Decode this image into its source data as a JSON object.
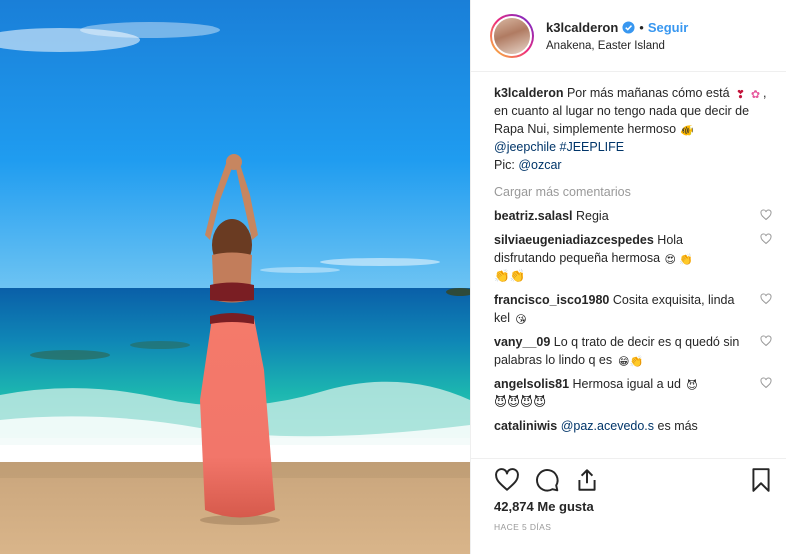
{
  "post": {
    "username": "k3lcalderon",
    "follow_label": "Seguir",
    "separator": "•",
    "location": "Anakena, Easter Island"
  },
  "caption": {
    "username": "k3lcalderon",
    "text_1": "Por más mañanas cómo está",
    "emoji_1": "❣",
    "emoji_2": "✿",
    "text_2": ", en cuanto al lugar no tengo nada que decir de Rapa Nui, simplemente hermoso",
    "emoji_3": "🐠",
    "mention_1": "@jeepchile",
    "hashtag_1": "#JEEPLIFE",
    "pic_label": "Pic:",
    "mention_2": "@ozcar"
  },
  "load_more_label": "Cargar más comentarios",
  "comments": [
    {
      "user": "beatriz.salasl",
      "text": "Regia"
    },
    {
      "user": "silviaeugeniadiazcespedes",
      "text": "Hola disfrutando pequeña hermosa",
      "emojis": "😍 👏",
      "emojis_2": "👏👏"
    },
    {
      "user": "francisco_isco1980",
      "text": "Cosita exquisita, linda kel",
      "emojis": "😘"
    },
    {
      "user": "vany__09",
      "text": "Lo q trato de decir es q quedó sin palabras lo lindo q es",
      "emojis": "😁👏"
    },
    {
      "user": "angelsolis81",
      "text": "Hermosa igual a ud",
      "emojis": "😈",
      "emojis_2": "😈😈😈😈"
    },
    {
      "user": "cataliniwis",
      "mention": "@paz.acevedo.s",
      "text": "es más"
    }
  ],
  "likes": "42,874 Me gusta",
  "timestamp": "HACE 5 DÍAS",
  "colors": {
    "accent": "#3897f0",
    "link": "#003569",
    "muted": "#999999",
    "text": "#262626",
    "border": "#efefef"
  },
  "icons": [
    "verified-icon",
    "heart-icon",
    "comment-icon",
    "share-icon",
    "bookmark-icon"
  ]
}
